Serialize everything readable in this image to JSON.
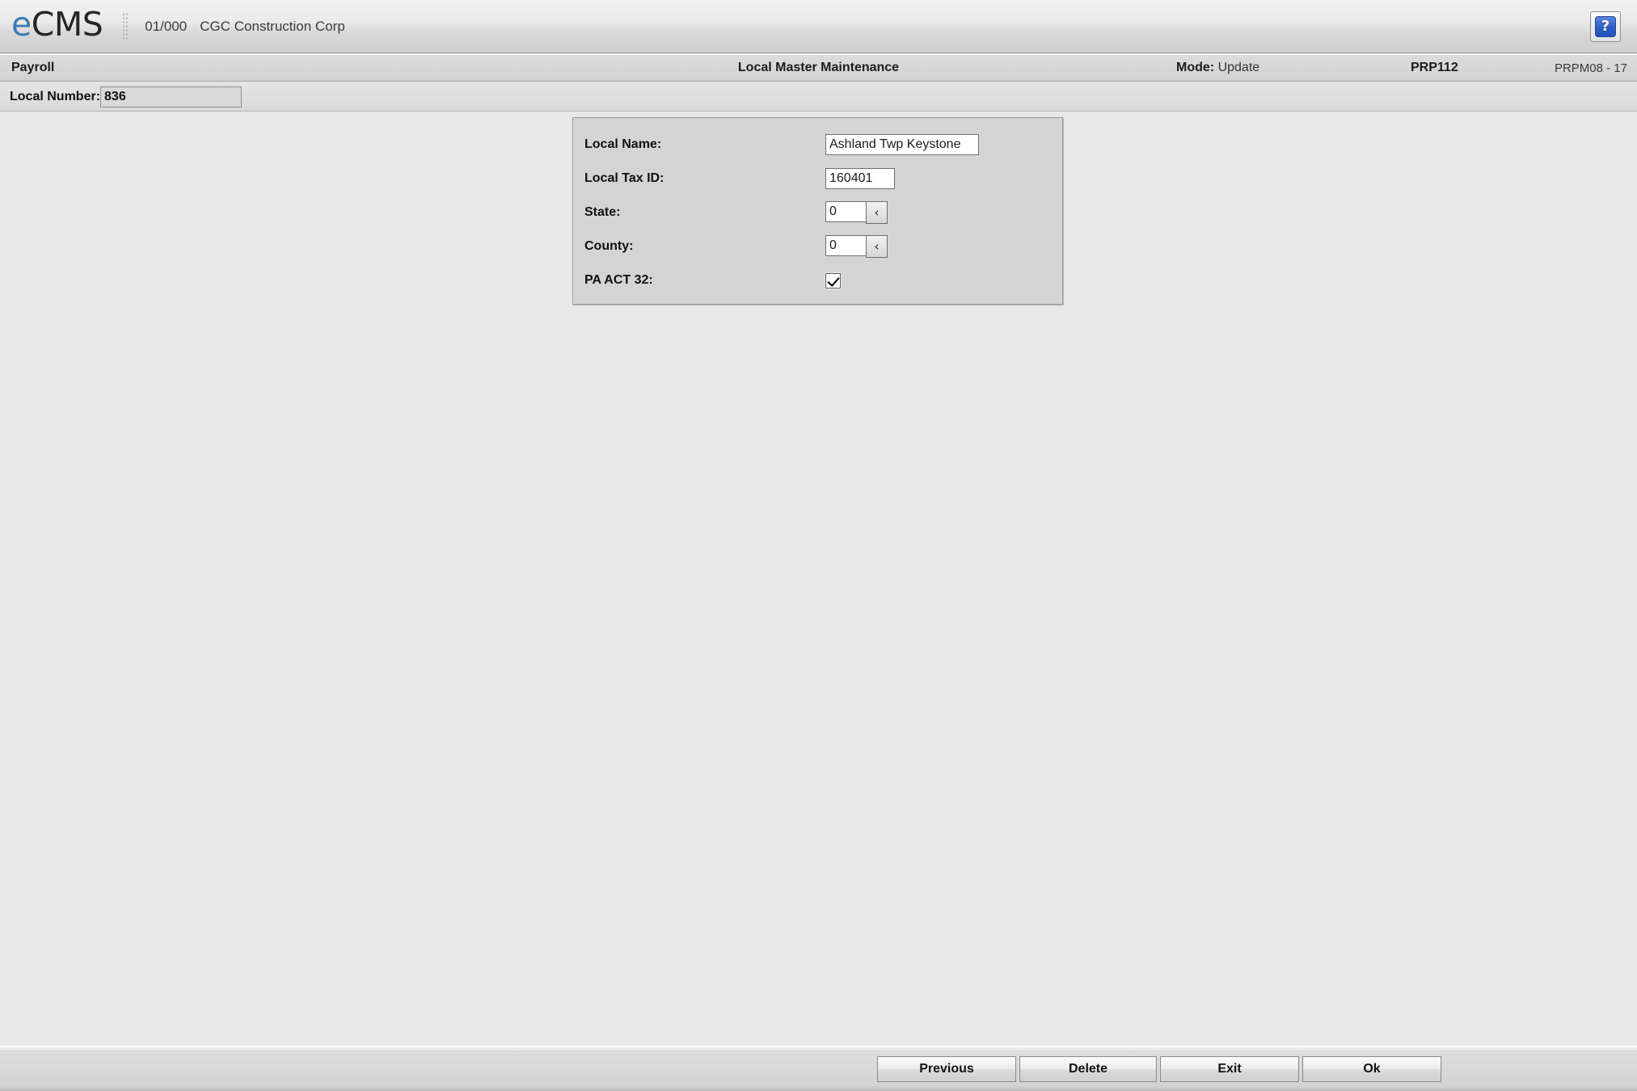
{
  "appbar": {
    "logo_e": "e",
    "logo_cms": "CMS",
    "company_code": "01/000",
    "company_name": "CGC Construction Corp",
    "help_label": "?",
    "help_icon": "question-mark-icon",
    "grip_icon": "drag-grip-icon",
    "accent_color": "#3d7cb5"
  },
  "titlebar": {
    "module": "Payroll",
    "title": "Local Master Maintenance",
    "mode_label": "Mode:",
    "mode_value": "Update",
    "program_id": "PRP112",
    "screen_id": "PRPM08 - 17"
  },
  "keybar": {
    "label": "Local Number:",
    "value": "836",
    "placeholder": ""
  },
  "form": {
    "fields": [
      {
        "label": "Local Name:",
        "value": "Ashland Twp Keystone",
        "type": "text"
      },
      {
        "label": "Local Tax ID:",
        "value": "160401",
        "type": "text"
      },
      {
        "label": "State:",
        "value": "0",
        "type": "lookup",
        "lookup_icon": "chevron-left-icon",
        "lookup_glyph": "‹"
      },
      {
        "label": "County:",
        "value": "0",
        "type": "lookup",
        "lookup_icon": "chevron-left-icon",
        "lookup_glyph": "‹"
      },
      {
        "label": "PA ACT 32:",
        "value": "",
        "type": "checkbox",
        "checked": true
      }
    ]
  },
  "footer": {
    "buttons": [
      {
        "label": "Previous"
      },
      {
        "label": "Delete"
      },
      {
        "label": "Exit"
      },
      {
        "label": "Ok"
      }
    ]
  }
}
